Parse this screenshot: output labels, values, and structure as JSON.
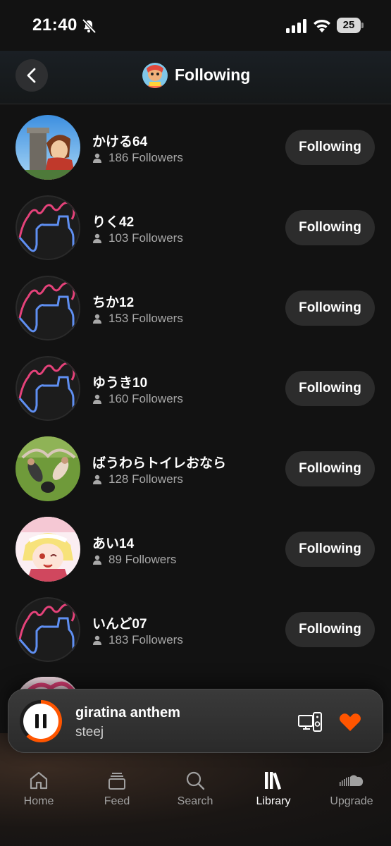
{
  "status_bar": {
    "time": "21:40",
    "battery": "25"
  },
  "header": {
    "title": "Following"
  },
  "list": [
    {
      "name": "かける64",
      "followers": "186 Followers",
      "button": "Following",
      "avatar": "anime-boy"
    },
    {
      "name": "りく42",
      "followers": "103 Followers",
      "button": "Following",
      "avatar": "squiggle"
    },
    {
      "name": "ちか12",
      "followers": "153 Followers",
      "button": "Following",
      "avatar": "squiggle"
    },
    {
      "name": "ゆうき10",
      "followers": "160 Followers",
      "button": "Following",
      "avatar": "squiggle"
    },
    {
      "name": "ばうわらトイレおなら",
      "followers": "128 Followers",
      "button": "Following",
      "avatar": "soccer-photo"
    },
    {
      "name": "あい14",
      "followers": "89 Followers",
      "button": "Following",
      "avatar": "anime-girl"
    },
    {
      "name": "いんど07",
      "followers": "183 Followers",
      "button": "Following",
      "avatar": "squiggle"
    }
  ],
  "player": {
    "title": "giratina anthem",
    "artist": "steej",
    "progress": 0.62
  },
  "tabs": [
    {
      "label": "Home",
      "icon": "home-icon",
      "active": false
    },
    {
      "label": "Feed",
      "icon": "feed-icon",
      "active": false
    },
    {
      "label": "Search",
      "icon": "search-icon",
      "active": false
    },
    {
      "label": "Library",
      "icon": "library-icon",
      "active": true
    },
    {
      "label": "Upgrade",
      "icon": "cloud-icon",
      "active": false
    }
  ],
  "colors": {
    "accent": "#ff5500",
    "background": "#121212",
    "button": "#2c2c2c"
  }
}
